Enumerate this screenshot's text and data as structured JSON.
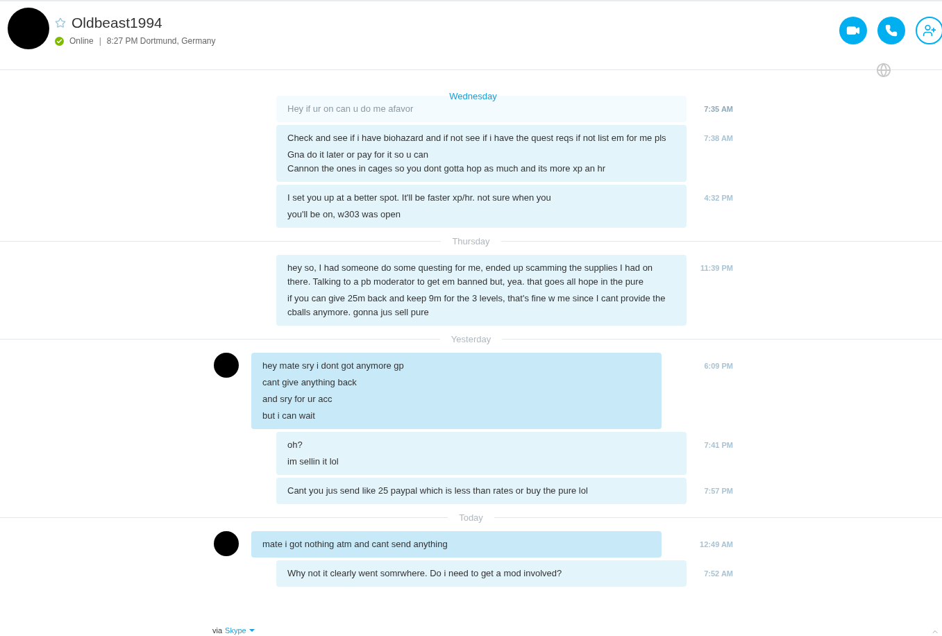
{
  "contact": {
    "name": "Oldbeast1994",
    "status": "Online",
    "separator": "|",
    "local_info": "8:27 PM Dortmund, Germany",
    "favorite": false,
    "online": true
  },
  "sticky_day": "Wednesday",
  "timeline": [
    {
      "kind": "message_out",
      "faded": true,
      "time": "7:35 AM",
      "lines": [
        "Hey if ur on can u do me afavor"
      ]
    },
    {
      "kind": "message_out",
      "faded": false,
      "time": "7:38 AM",
      "lines": [
        "Check and see if i have biohazard and if not see if i have the quest reqs if not list em for me pls",
        "Gna do it later or pay for it so u can\nCannon the ones in cages so you dont gotta hop as much and its more xp an hr"
      ]
    },
    {
      "kind": "message_out",
      "faded": false,
      "time": "4:32 PM",
      "lines": [
        "I set you up at a better spot. It'll be faster xp/hr. not sure when you",
        "you'll be on, w303 was open"
      ]
    },
    {
      "kind": "day",
      "label": "Thursday"
    },
    {
      "kind": "message_out",
      "faded": false,
      "time": "11:39 PM",
      "lines": [
        "hey so, I had someone do some questing for me, ended up scamming the supplies I had on there. Talking to a pb moderator to get em banned but, yea. that goes all hope in the pure",
        "if you can give 25m back and keep 9m for the 3 levels, that's fine w me since I cant provide the cballs anymore. gonna jus sell pure"
      ]
    },
    {
      "kind": "day",
      "label": "Yesterday"
    },
    {
      "kind": "message_in",
      "faded": false,
      "time": "6:09 PM",
      "lines": [
        "hey mate sry i dont got anymore gp",
        "cant give anything back",
        "and sry for ur acc",
        "but i can wait"
      ]
    },
    {
      "kind": "message_out",
      "faded": false,
      "time": "7:41 PM",
      "lines": [
        "oh?",
        "im sellin it lol"
      ]
    },
    {
      "kind": "message_out",
      "faded": false,
      "time": "7:57 PM",
      "lines": [
        "Cant you jus send like 25 paypal which is less than rates or buy the pure lol"
      ]
    },
    {
      "kind": "day",
      "label": "Today"
    },
    {
      "kind": "message_in",
      "faded": false,
      "time": "12:49 AM",
      "lines": [
        "mate i got nothing atm and cant send anything"
      ]
    },
    {
      "kind": "message_out",
      "faded": false,
      "time": "7:52 AM",
      "lines": [
        "Why not it clearly went somrwhere. Do i need to get a mod involved?"
      ]
    }
  ],
  "footer": {
    "prefix": "via",
    "service": "Skype"
  }
}
